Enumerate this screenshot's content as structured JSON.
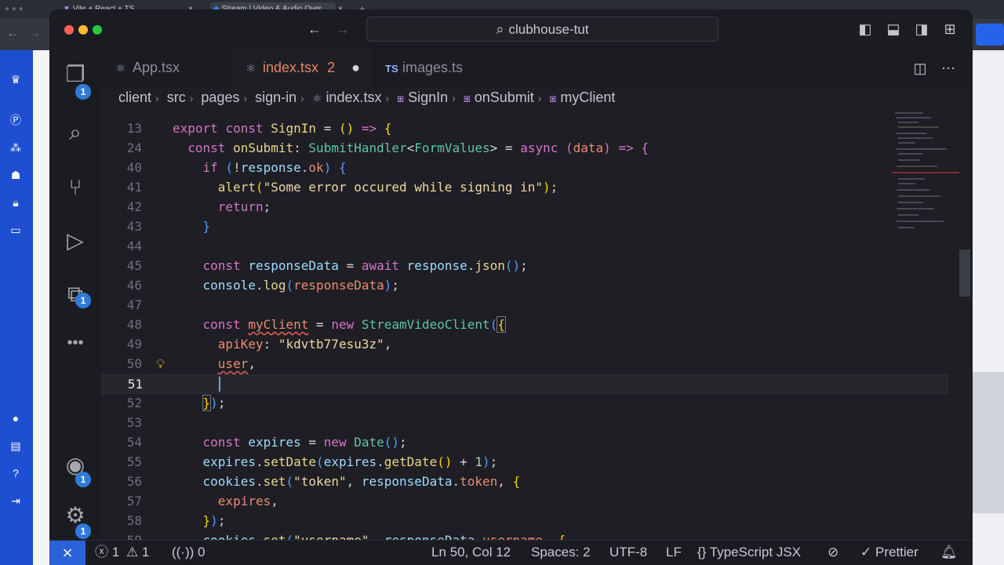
{
  "browser": {
    "tabs": [
      {
        "title": "Vite + React + TS"
      },
      {
        "title": "Stream | Video & Audio Over..."
      }
    ],
    "new_tab_symbol": "+"
  },
  "window": {
    "title": "clubhouse-tut"
  },
  "activity_bar": {
    "explorer_badge": "1",
    "extensions_badge": "1",
    "accounts_badge": "1",
    "settings_badge": "1"
  },
  "tabs": [
    {
      "label": "App.tsx",
      "icon": "react-icon"
    },
    {
      "label": "index.tsx",
      "count": "2",
      "icon": "react-icon",
      "active": true,
      "modified": true
    },
    {
      "label": "images.ts",
      "icon": "ts-icon",
      "prefix": "TS"
    }
  ],
  "breadcrumb": [
    "client",
    "src",
    "pages",
    "sign-in",
    "index.tsx",
    "SignIn",
    "onSubmit",
    "myClient"
  ],
  "editor": {
    "current_line": "51",
    "lines": [
      {
        "n": "13"
      },
      {
        "n": "24"
      },
      {
        "n": "40"
      },
      {
        "n": "41"
      },
      {
        "n": "42"
      },
      {
        "n": "43"
      },
      {
        "n": "44"
      },
      {
        "n": "45"
      },
      {
        "n": "46"
      },
      {
        "n": "47"
      },
      {
        "n": "48"
      },
      {
        "n": "49"
      },
      {
        "n": "50"
      },
      {
        "n": "51"
      },
      {
        "n": "52"
      },
      {
        "n": "53"
      },
      {
        "n": "54"
      },
      {
        "n": "55"
      },
      {
        "n": "56"
      },
      {
        "n": "57"
      },
      {
        "n": "58"
      },
      {
        "n": "59"
      }
    ]
  },
  "status": {
    "errors": "1",
    "warnings": "1",
    "ports": "0",
    "position": "Ln 50, Col 12",
    "spaces": "Spaces: 2",
    "encoding": "UTF-8",
    "eol": "LF",
    "language": "TypeScript JSX",
    "formatter": "Prettier"
  },
  "colors": {
    "accent": "#2b62d9",
    "tab_active": "#e5866b",
    "badge": "#2f7bd8"
  }
}
